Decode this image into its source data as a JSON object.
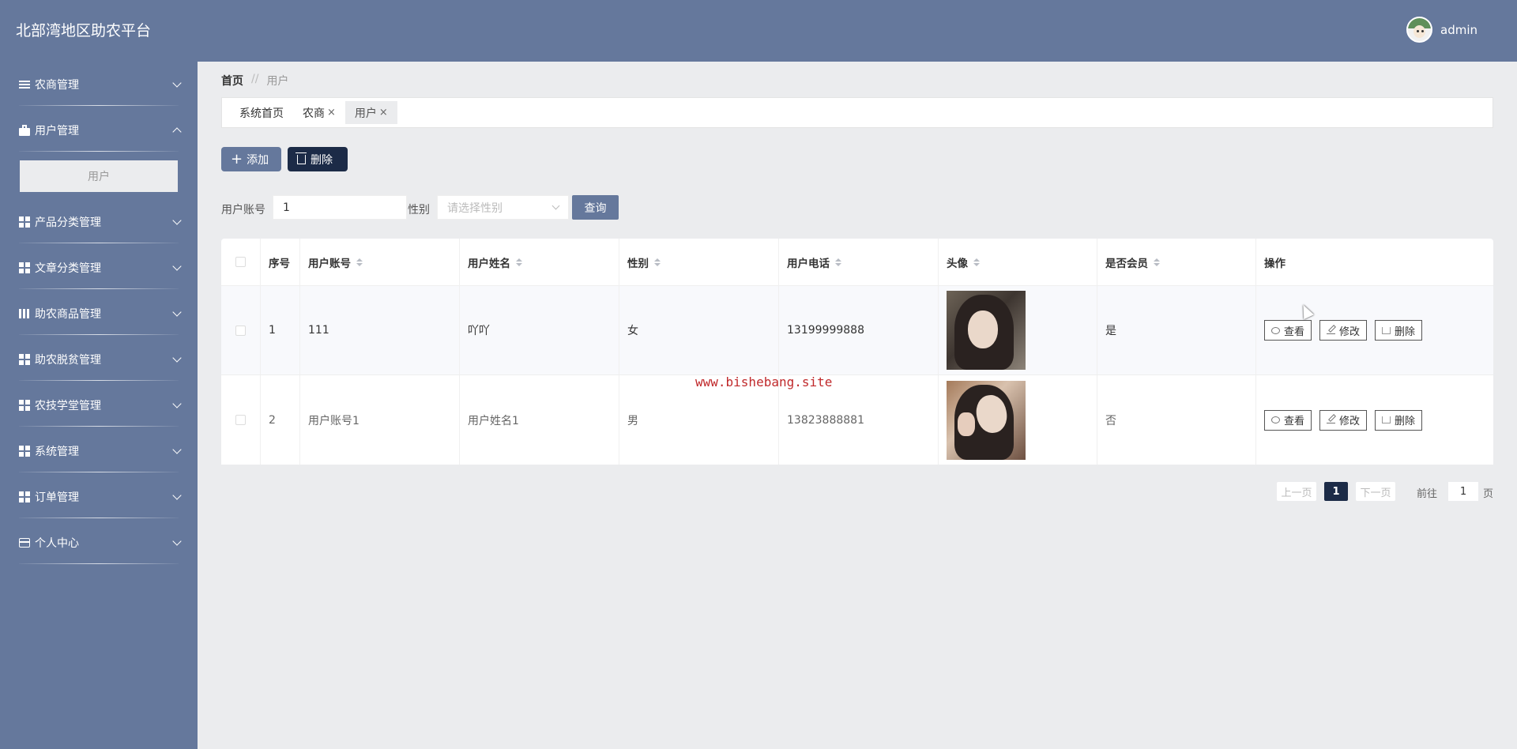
{
  "header": {
    "brand": "北部湾地区助农平台",
    "username": "admin"
  },
  "sidebar": {
    "items": [
      {
        "label": "农商管理",
        "icon": "list-icon",
        "expanded": false
      },
      {
        "label": "用户管理",
        "icon": "bag-icon",
        "expanded": true,
        "children": [
          {
            "label": "用户"
          }
        ]
      },
      {
        "label": "产品分类管理",
        "icon": "grid-icon",
        "expanded": false
      },
      {
        "label": "文章分类管理",
        "icon": "grid-icon",
        "expanded": false
      },
      {
        "label": "助农商品管理",
        "icon": "book-icon",
        "expanded": false
      },
      {
        "label": "助农脱贫管理",
        "icon": "grid-icon",
        "expanded": false
      },
      {
        "label": "农技学堂管理",
        "icon": "grid-icon",
        "expanded": false
      },
      {
        "label": "系统管理",
        "icon": "grid-icon",
        "expanded": false
      },
      {
        "label": "订单管理",
        "icon": "grid-icon",
        "expanded": false
      },
      {
        "label": "个人中心",
        "icon": "card-icon",
        "expanded": false
      }
    ]
  },
  "breadcrumb": {
    "home": "首页",
    "sep": "//",
    "current": "用户"
  },
  "tabs": [
    {
      "label": "系统首页",
      "closable": false
    },
    {
      "label": "农商",
      "closable": true
    },
    {
      "label": "用户",
      "closable": true,
      "active": true
    }
  ],
  "tab_close": "×",
  "actions": {
    "add": "添加",
    "delete": "删除"
  },
  "search": {
    "account_label": "用户账号",
    "account_value": "1",
    "gender_label": "性别",
    "gender_placeholder": "请选择性别",
    "query": "查询"
  },
  "table": {
    "columns": [
      "序号",
      "用户账号",
      "用户姓名",
      "性别",
      "用户电话",
      "头像",
      "是否会员",
      "操作"
    ],
    "rows": [
      {
        "index": "1",
        "account": "111",
        "name": "吖吖",
        "gender": "女",
        "phone": "13199999888",
        "vip": "是"
      },
      {
        "index": "2",
        "account": "用户账号1",
        "name": "用户姓名1",
        "gender": "男",
        "phone": "13823888881",
        "vip": "否"
      }
    ],
    "row_actions": {
      "view": "查看",
      "edit": "修改",
      "delete": "删除"
    }
  },
  "watermark": "www.bishebang.site",
  "pagination": {
    "prev": "上一页",
    "current": "1",
    "next": "下一页",
    "goto_label": "前往",
    "goto_value": "1",
    "goto_unit": "页"
  },
  "colors": {
    "primary": "#65789c",
    "dark": "#1c2b47",
    "background": "#ebecee"
  }
}
